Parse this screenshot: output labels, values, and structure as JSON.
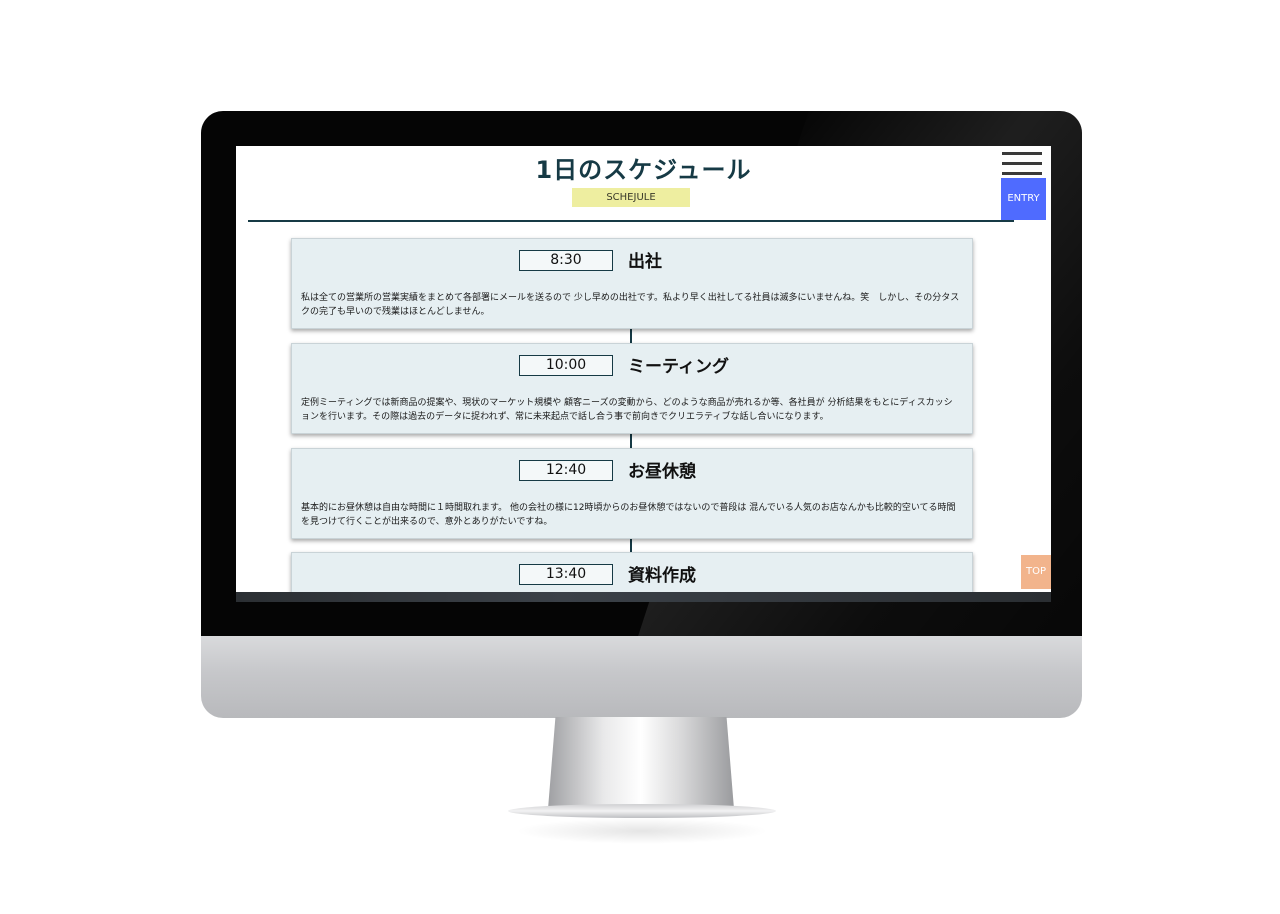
{
  "header": {
    "title": "1日のスケジュール",
    "badge": "SCHEJULE",
    "entry_label": "ENTRY",
    "top_label": "TOP"
  },
  "schedule": [
    {
      "time": "8:30",
      "title": "出社",
      "body": "私は全ての営業所の営業実績をまとめて各部署にメールを送るので 少し早めの出社です。私より早く出社してる社員は滅多にいませんね。笑　しかし、その分タスクの完了も早いので残業はほとんどしません。"
    },
    {
      "time": "10:00",
      "title": "ミーティング",
      "body": "定例ミーティングでは新商品の提案や、現状のマーケット規模や 顧客ニーズの変動から、どのような商品が売れるか等、各社員が 分析結果をもとにディスカッションを行います。その際は過去のデータに捉われず、常に未来起点で話し合う事で前向きでクリエラティブな話し合いになります。"
    },
    {
      "time": "12:40",
      "title": "お昼休憩",
      "body": "基本的にお昼休憩は自由な時間に１時間取れます。 他の会社の様に12時頃からのお昼休憩ではないので普段は 混んでいる人気のお店なんかも比較的空いてる時間を見つけて行くことが出来るので、意外とありがたいですね。"
    },
    {
      "time": "13:40",
      "title": "資料作成",
      "body": ""
    }
  ],
  "colors": {
    "accent": "#163a45",
    "entry_button": "#4f6bff",
    "top_button": "#f2b48c",
    "badge": "#eeeea0",
    "card_bg": "#e6eff2"
  }
}
